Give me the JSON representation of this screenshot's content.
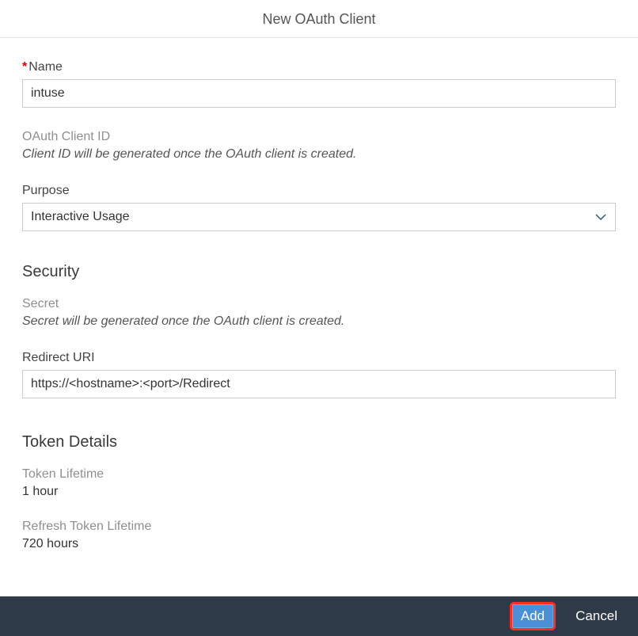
{
  "header": {
    "title": "New OAuth Client"
  },
  "fields": {
    "name": {
      "label": "Name",
      "value": "intuse",
      "required_marker": "*"
    },
    "client_id": {
      "label": "OAuth Client ID",
      "note": "Client ID will be generated once the OAuth client is created."
    },
    "purpose": {
      "label": "Purpose",
      "value": "Interactive Usage"
    }
  },
  "security": {
    "heading": "Security",
    "secret": {
      "label": "Secret",
      "note": "Secret will be generated once the OAuth client is created."
    },
    "redirect_uri": {
      "label": "Redirect URI",
      "value": "https://<hostname>:<port>/Redirect"
    }
  },
  "token_details": {
    "heading": "Token Details",
    "token_lifetime": {
      "label": "Token Lifetime",
      "value": "1 hour"
    },
    "refresh_token_lifetime": {
      "label": "Refresh Token Lifetime",
      "value": "720 hours"
    }
  },
  "footer": {
    "add_label": "Add",
    "cancel_label": "Cancel"
  }
}
